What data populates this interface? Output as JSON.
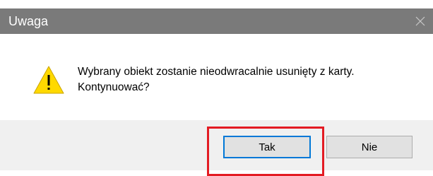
{
  "dialog": {
    "title": "Uwaga",
    "close_icon": "close-icon",
    "warning_icon": "warning-icon",
    "message_line1": "Wybrany obiekt zostanie nieodwracalnie usunięty z karty.",
    "message_line2": "Kontynuować?",
    "yes_label": "Tak",
    "no_label": "Nie"
  },
  "colors": {
    "titlebar": "#7a7a7a",
    "warning_fill": "#ffd900",
    "default_button_border": "#0078d7",
    "highlight": "#e31b23"
  }
}
